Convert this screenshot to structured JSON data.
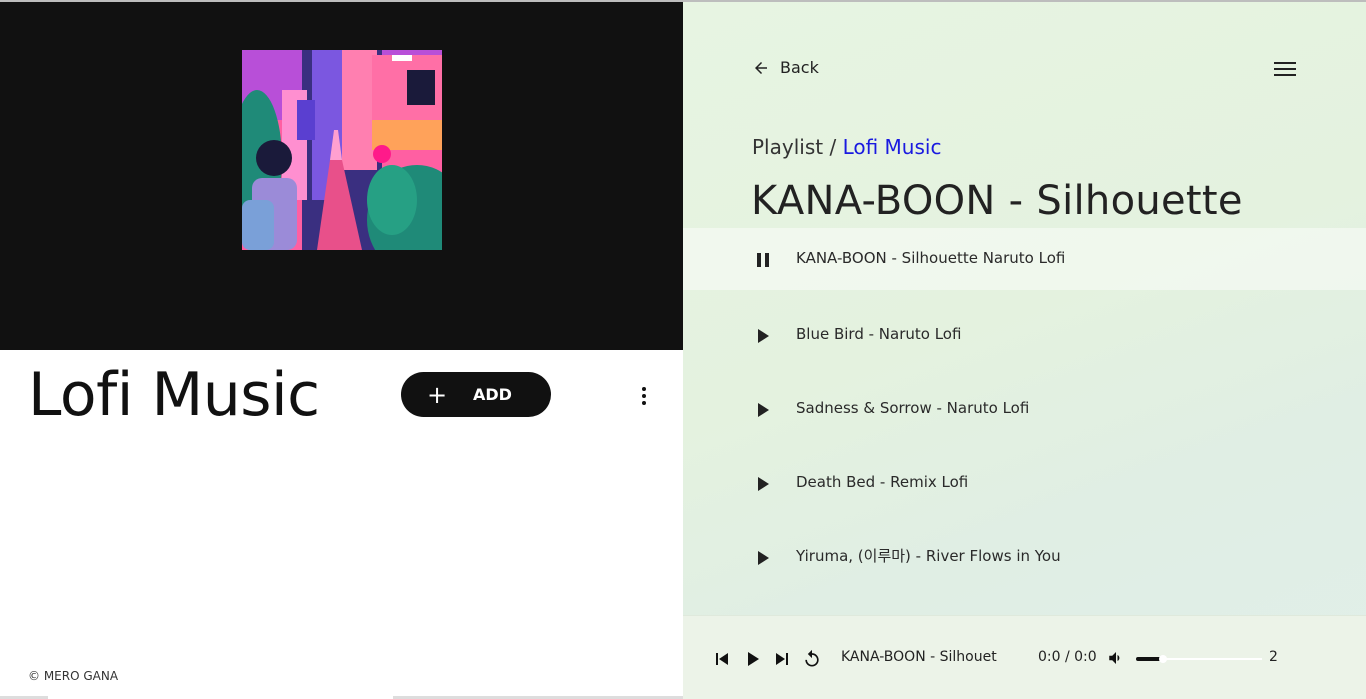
{
  "playlist": {
    "title": "Lofi Music",
    "add_label": "ADD",
    "add_icon": "plus-icon",
    "more_icon": "more-vert-icon"
  },
  "footer": {
    "copyright": "© MERO GANA"
  },
  "nav": {
    "back_label": "Back",
    "back_icon": "arrow-left-icon",
    "menu_icon": "hamburger-icon"
  },
  "breadcrumb": {
    "prefix": "Playlist",
    "separator": "/",
    "link": "Lofi Music"
  },
  "now_playing": {
    "title": "KANA-BOON - Silhouette"
  },
  "tracks": [
    {
      "name": "KANA-BOON - Silhouette Naruto Lofi",
      "state": "playing",
      "icon": "pause-icon"
    },
    {
      "name": "Blue Bird - Naruto Lofi",
      "state": "idle",
      "icon": "play-icon"
    },
    {
      "name": "Sadness & Sorrow - Naruto Lofi",
      "state": "idle",
      "icon": "play-icon"
    },
    {
      "name": "Death Bed - Remix Lofi",
      "state": "idle",
      "icon": "play-icon"
    },
    {
      "name": "Yiruma, (이루마) - River Flows in You",
      "state": "idle",
      "icon": "play-icon"
    }
  ],
  "player": {
    "current_track": "KANA-BOON - Silhouet",
    "time": "0:0 / 0:0",
    "volume_value": "2",
    "volume_fraction": 0.2,
    "controls": [
      "skip-previous-icon",
      "play-icon",
      "skip-next-icon",
      "replay-icon",
      "volume-icon"
    ]
  },
  "colors": {
    "accent_link": "#1a1ae0",
    "dark": "#111111",
    "panel_bg": "#e4f2df"
  }
}
